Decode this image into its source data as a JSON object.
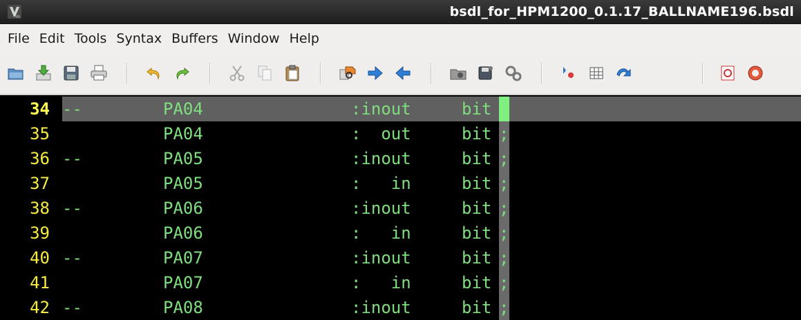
{
  "window": {
    "title": "bsdl_for_HPM1200_0.1.17_BALLNAME196.bsdl"
  },
  "menu": [
    "File",
    "Edit",
    "Tools",
    "Syntax",
    "Buffers",
    "Window",
    "Help"
  ],
  "toolbar": {
    "icons": [
      "open-icon",
      "save-download-icon",
      "save-icon",
      "print-icon",
      "undo-icon",
      "redo-icon",
      "cut-icon",
      "copy-icon",
      "paste-icon",
      "find-replace-icon",
      "find-next-icon",
      "find-previous-icon",
      "load-session-icon",
      "save-session-icon",
      "run-script-icon",
      "make-icon",
      "shell-icon",
      "jump-tag-icon",
      "help-icon",
      "find-help-icon"
    ]
  },
  "editor": {
    "colors": {
      "line_number": "#f6ec44",
      "text": "#7fdf7f",
      "cursorline": "#606060",
      "colorcolumn": "#6a6a6a",
      "cursor": "#7fef7f"
    },
    "lines": [
      {
        "num": "34",
        "comment": "--",
        "name": "PA04",
        "dir": ":inout",
        "type": "bit",
        "term": ";",
        "current": true
      },
      {
        "num": "35",
        "comment": "",
        "name": "PA04",
        "dir": ":  out",
        "type": "bit",
        "term": ";",
        "current": false
      },
      {
        "num": "36",
        "comment": "--",
        "name": "PA05",
        "dir": ":inout",
        "type": "bit",
        "term": ";",
        "current": false
      },
      {
        "num": "37",
        "comment": "",
        "name": "PA05",
        "dir": ":   in",
        "type": "bit",
        "term": ";",
        "current": false
      },
      {
        "num": "38",
        "comment": "--",
        "name": "PA06",
        "dir": ":inout",
        "type": "bit",
        "term": ";",
        "current": false
      },
      {
        "num": "39",
        "comment": "",
        "name": "PA06",
        "dir": ":   in",
        "type": "bit",
        "term": ";",
        "current": false
      },
      {
        "num": "40",
        "comment": "--",
        "name": "PA07",
        "dir": ":inout",
        "type": "bit",
        "term": ";",
        "current": false
      },
      {
        "num": "41",
        "comment": "",
        "name": "PA07",
        "dir": ":   in",
        "type": "bit",
        "term": ";",
        "current": false
      },
      {
        "num": "42",
        "comment": "--",
        "name": "PA08",
        "dir": ":inout",
        "type": "bit",
        "term": ";",
        "current": false
      }
    ]
  }
}
